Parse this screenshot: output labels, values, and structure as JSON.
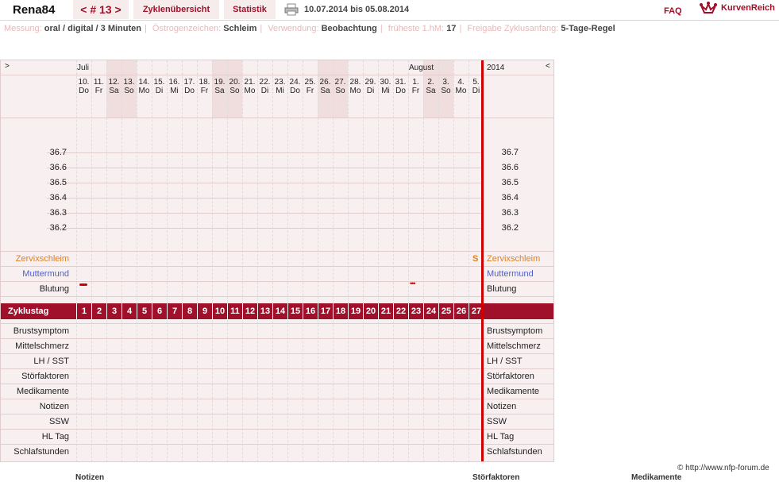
{
  "header": {
    "username": "Rena84",
    "cycle_nav": "< # 13 >",
    "tab_overview": "Zyklenübersicht",
    "tab_stats": "Statistik",
    "date_range": "10.07.2014 bis 05.08.2014",
    "faq": "FAQ",
    "logo_text": "KurvenReich"
  },
  "info": [
    {
      "key": "Messung:",
      "value": "oral / digital / 3 Minuten"
    },
    {
      "key": "Östrogenzeichen:",
      "value": "Schleim"
    },
    {
      "key": "Verwendung:",
      "value": "Beobachtung"
    },
    {
      "key": "früheste 1.hM:",
      "value": "17"
    },
    {
      "key": "Freigabe Zyklusanfang:",
      "value": "5-Tage-Regel"
    }
  ],
  "chart": {
    "left_nav": ">",
    "right_nav": "<",
    "month1": "Juli",
    "month2": "August",
    "year": "2014",
    "days": [
      {
        "n": "10.",
        "d": "Do",
        "we": false
      },
      {
        "n": "11.",
        "d": "Fr",
        "we": false
      },
      {
        "n": "12.",
        "d": "Sa",
        "we": true
      },
      {
        "n": "13.",
        "d": "So",
        "we": true
      },
      {
        "n": "14.",
        "d": "Mo",
        "we": false
      },
      {
        "n": "15.",
        "d": "Di",
        "we": false
      },
      {
        "n": "16.",
        "d": "Mi",
        "we": false
      },
      {
        "n": "17.",
        "d": "Do",
        "we": false
      },
      {
        "n": "18.",
        "d": "Fr",
        "we": false
      },
      {
        "n": "19.",
        "d": "Sa",
        "we": true
      },
      {
        "n": "20.",
        "d": "So",
        "we": true
      },
      {
        "n": "21.",
        "d": "Mo",
        "we": false
      },
      {
        "n": "22.",
        "d": "Di",
        "we": false
      },
      {
        "n": "23.",
        "d": "Mi",
        "we": false
      },
      {
        "n": "24.",
        "d": "Do",
        "we": false
      },
      {
        "n": "25.",
        "d": "Fr",
        "we": false
      },
      {
        "n": "26.",
        "d": "Sa",
        "we": true
      },
      {
        "n": "27.",
        "d": "So",
        "we": true
      },
      {
        "n": "28.",
        "d": "Mo",
        "we": false
      },
      {
        "n": "29.",
        "d": "Di",
        "we": false
      },
      {
        "n": "30.",
        "d": "Mi",
        "we": false
      },
      {
        "n": "31.",
        "d": "Do",
        "we": false
      },
      {
        "n": "1.",
        "d": "Fr",
        "we": false
      },
      {
        "n": "2.",
        "d": "Sa",
        "we": true
      },
      {
        "n": "3.",
        "d": "So",
        "we": true
      },
      {
        "n": "4.",
        "d": "Mo",
        "we": false
      },
      {
        "n": "5.",
        "d": "Di",
        "we": false
      }
    ],
    "temps": [
      "36.7",
      "36.6",
      "36.5",
      "36.4",
      "36.3",
      "36.2"
    ],
    "obs_rows": [
      "Zervixschleim",
      "Muttermund",
      "Blutung"
    ],
    "zyklus_label": "Zyklustag",
    "cycle_days": [
      "1",
      "2",
      "3",
      "4",
      "5",
      "6",
      "7",
      "8",
      "9",
      "10",
      "11",
      "12",
      "13",
      "14",
      "15",
      "16",
      "17",
      "18",
      "19",
      "20",
      "21",
      "22",
      "23",
      "24",
      "25",
      "26",
      "27"
    ],
    "lower_rows": [
      "Brustsymptom",
      "Mittelschmerz",
      "LH / SST",
      "Störfaktoren",
      "Medikamente",
      "Notizen",
      "SSW",
      "HL Tag",
      "Schlafstunden"
    ],
    "mucus_marker": "S",
    "bleeding_marker": "•••",
    "colors": {
      "accent": "#a0102a",
      "mucus": "#e08020",
      "cervix": "#5060c0"
    }
  },
  "footer": {
    "credit": "© http://www.nfp-forum.de",
    "bottom_labels": [
      "Notizen",
      "Störfaktoren",
      "Medikamente"
    ]
  }
}
